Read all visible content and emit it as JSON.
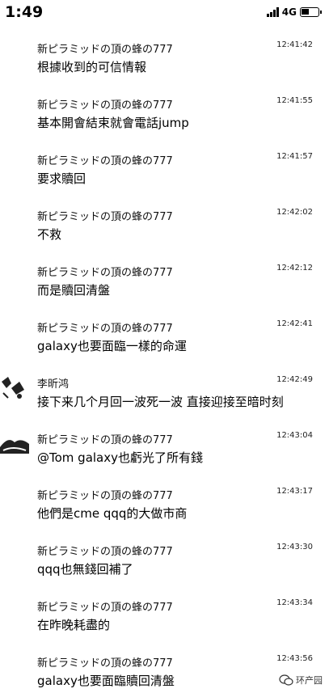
{
  "status_bar": {
    "time": "1:49",
    "network": "4G",
    "icons": [
      "signal-icon",
      "battery-icon"
    ]
  },
  "messages": [
    {
      "sender": "新ピラミッドの頂の蜂の777",
      "time": "12:41:42",
      "text": "根據收到的可信情報"
    },
    {
      "sender": "新ピラミッドの頂の蜂の777",
      "time": "12:41:55",
      "text": "基本開會結束就會電話jump"
    },
    {
      "sender": "新ピラミッドの頂の蜂の777",
      "time": "12:41:57",
      "text": "要求贖回"
    },
    {
      "sender": "新ピラミッドの頂の蜂の777",
      "time": "12:42:02",
      "text": "不救"
    },
    {
      "sender": "新ピラミッドの頂の蜂の777",
      "time": "12:42:12",
      "text": "而是贖回清盤"
    },
    {
      "sender": "新ピラミッドの頂の蜂の777",
      "time": "12:42:41",
      "text": "galaxy也要面臨一樣的命運"
    },
    {
      "sender": "李昕鸿",
      "time": "12:42:49",
      "text": "接下来几个月回一波死一波 直接迎接至暗时刻"
    },
    {
      "sender": "新ピラミッドの頂の蜂の777",
      "time": "12:43:04",
      "text": "@Tom galaxy也虧光了所有錢"
    },
    {
      "sender": "新ピラミッドの頂の蜂の777",
      "time": "12:43:17",
      "text": "他們是cme qqq的大做市商"
    },
    {
      "sender": "新ピラミッドの頂の蜂の777",
      "time": "12:43:30",
      "text": "qqq也無錢回補了"
    },
    {
      "sender": "新ピラミッドの頂の蜂の777",
      "time": "12:43:34",
      "text": "在昨晚耗盡的"
    },
    {
      "sender": "新ピラミッドの頂の蜂の777",
      "time": "12:43:56",
      "text": "galaxy也要面臨贖回清盤"
    }
  ],
  "watermark": {
    "text": "环产园",
    "icon": "wechat-icon"
  }
}
